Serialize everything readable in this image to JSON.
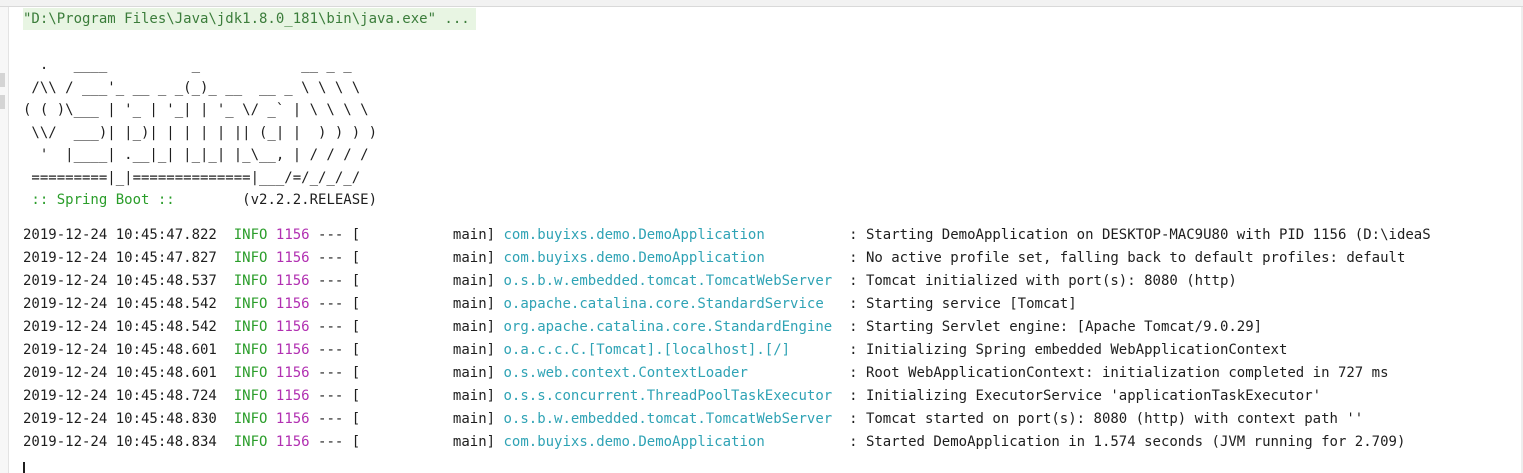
{
  "console": {
    "command": "\"D:\\Program Files\\Java\\jdk1.8.0_181\\bin\\java.exe\" ...",
    "banner": [
      "  .   ____          _            __ _ _",
      " /\\\\ / ___'_ __ _ _(_)_ __  __ _ \\ \\ \\ \\",
      "( ( )\\___ | '_ | '_| | '_ \\/ _` | \\ \\ \\ \\",
      " \\\\/  ___)| |_)| | | | | || (_| |  ) ) ) )",
      "  '  |____| .__|_| |_|_| |_\\__, | / / / /",
      " =========|_|==============|___/=/_/_/_/"
    ],
    "boot_label": " :: Spring Boot :: ",
    "boot_version": "       (v2.2.2.RELEASE)",
    "logs": [
      {
        "time": "2019-12-24 10:45:47.822",
        "level": "INFO",
        "pid": "1156",
        "thread": "main",
        "logger": "com.buyixs.demo.DemoApplication",
        "message": "Starting DemoApplication on DESKTOP-MAC9U80 with PID 1156 (D:\\ideaS"
      },
      {
        "time": "2019-12-24 10:45:47.827",
        "level": "INFO",
        "pid": "1156",
        "thread": "main",
        "logger": "com.buyixs.demo.DemoApplication",
        "message": "No active profile set, falling back to default profiles: default"
      },
      {
        "time": "2019-12-24 10:45:48.537",
        "level": "INFO",
        "pid": "1156",
        "thread": "main",
        "logger": "o.s.b.w.embedded.tomcat.TomcatWebServer",
        "message": "Tomcat initialized with port(s): 8080 (http)"
      },
      {
        "time": "2019-12-24 10:45:48.542",
        "level": "INFO",
        "pid": "1156",
        "thread": "main",
        "logger": "o.apache.catalina.core.StandardService",
        "message": "Starting service [Tomcat]"
      },
      {
        "time": "2019-12-24 10:45:48.542",
        "level": "INFO",
        "pid": "1156",
        "thread": "main",
        "logger": "org.apache.catalina.core.StandardEngine",
        "message": "Starting Servlet engine: [Apache Tomcat/9.0.29]"
      },
      {
        "time": "2019-12-24 10:45:48.601",
        "level": "INFO",
        "pid": "1156",
        "thread": "main",
        "logger": "o.a.c.c.C.[Tomcat].[localhost].[/]",
        "message": "Initializing Spring embedded WebApplicationContext"
      },
      {
        "time": "2019-12-24 10:45:48.601",
        "level": "INFO",
        "pid": "1156",
        "thread": "main",
        "logger": "o.s.web.context.ContextLoader",
        "message": "Root WebApplicationContext: initialization completed in 727 ms"
      },
      {
        "time": "2019-12-24 10:45:48.724",
        "level": "INFO",
        "pid": "1156",
        "thread": "main",
        "logger": "o.s.s.concurrent.ThreadPoolTaskExecutor",
        "message": "Initializing ExecutorService 'applicationTaskExecutor'"
      },
      {
        "time": "2019-12-24 10:45:48.830",
        "level": "INFO",
        "pid": "1156",
        "thread": "main",
        "logger": "o.s.b.w.embedded.tomcat.TomcatWebServer",
        "message": "Tomcat started on port(s): 8080 (http) with context path ''"
      },
      {
        "time": "2019-12-24 10:45:48.834",
        "level": "INFO",
        "pid": "1156",
        "thread": "main",
        "logger": "com.buyixs.demo.DemoApplication",
        "message": "Started DemoApplication in 1.574 seconds (JVM running for 2.709)"
      }
    ]
  },
  "colors": {
    "command_bg": "#e8f5e3",
    "command_text": "#3b7d3b",
    "level_info": "#2a9d2a",
    "pid": "#b12fb1",
    "logger": "#2fa3b5",
    "text": "#1e1e1e"
  }
}
